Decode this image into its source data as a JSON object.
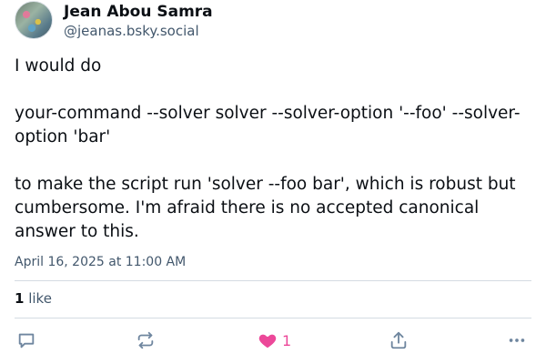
{
  "author": {
    "name": "Jean Abou Samra",
    "handle": "@jeanas.bsky.social"
  },
  "post": {
    "paragraphs": [
      "I would do",
      "your-command --solver solver --solver-option '--foo' --solver-option 'bar'",
      "to make the script run 'solver --foo bar', which is robust but cumbersome. I'm afraid there is no accepted canonical answer to this."
    ],
    "timestamp": "April 16, 2025 at 11:00 AM"
  },
  "stats": {
    "likes_count": "1",
    "likes_label": "like"
  },
  "actions": {
    "like_count": "1",
    "icons": [
      "reply-icon",
      "repost-icon",
      "heart-icon",
      "share-icon",
      "more-icon"
    ]
  },
  "colors": {
    "text": "#0b0f14",
    "muted": "#42576c",
    "icon": "#6f869f",
    "like": "#ec4899",
    "divider": "#d4dbe2"
  }
}
